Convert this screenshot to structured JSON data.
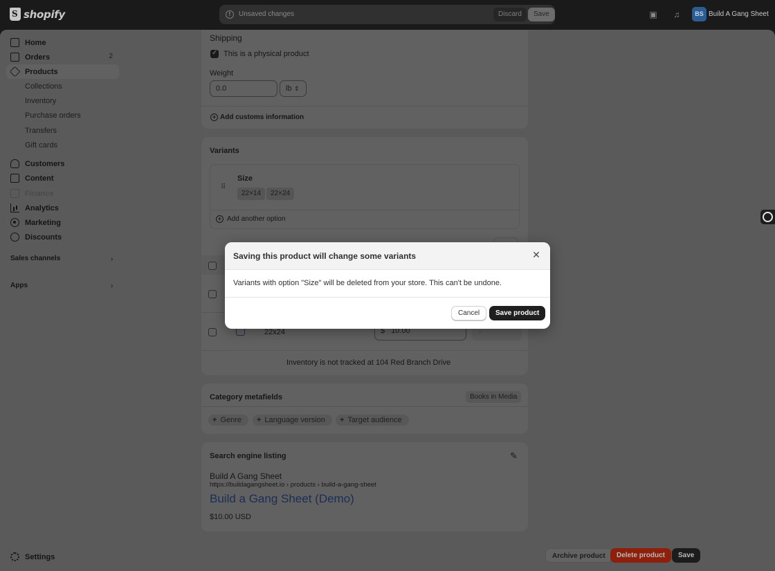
{
  "topbar": {
    "logo_text": "shopify",
    "unsaved_text": "Unsaved changes",
    "discard_label": "Discard",
    "save_label": "Save",
    "store_initials": "BS",
    "store_name": "Build A Gang Sheet"
  },
  "sidebar": {
    "items": [
      {
        "label": "Home",
        "icon": "home-icon"
      },
      {
        "label": "Orders",
        "icon": "orders-icon",
        "count": "2"
      },
      {
        "label": "Products",
        "icon": "tag-icon"
      },
      {
        "label": "Collections"
      },
      {
        "label": "Inventory"
      },
      {
        "label": "Purchase orders"
      },
      {
        "label": "Transfers"
      },
      {
        "label": "Gift cards"
      },
      {
        "label": "Customers",
        "icon": "person-icon"
      },
      {
        "label": "Content",
        "icon": "content-icon"
      },
      {
        "label": "Finance",
        "icon": "finance-icon"
      },
      {
        "label": "Analytics",
        "icon": "analytics-icon"
      },
      {
        "label": "Marketing",
        "icon": "target-icon"
      },
      {
        "label": "Discounts",
        "icon": "discount-icon"
      }
    ],
    "sales_channels_label": "Sales channels",
    "apps_label": "Apps",
    "settings_label": "Settings"
  },
  "shipping": {
    "title": "Shipping",
    "physical_label": "This is a physical product",
    "weight_label": "Weight",
    "weight_value": "0.0",
    "weight_unit": "lb",
    "customs_label": "Add customs information"
  },
  "variants": {
    "title": "Variants",
    "option_name": "Size",
    "option_values": [
      "22×14",
      "22×24"
    ],
    "add_option_label": "Add another option",
    "row_name": "22x24",
    "row_price_prefix": "$",
    "row_price": "10.00",
    "row_qty": "-",
    "inventory_note": "Inventory is not tracked at 104 Red Branch Drive"
  },
  "category_metafields": {
    "title": "Category metafields",
    "badge": "Books in Media",
    "pills": [
      "Genre",
      "Language version",
      "Target audience"
    ]
  },
  "seo": {
    "title": "Search engine listing",
    "store_name": "Build A Gang Sheet",
    "url": "https://buildagangsheet.io › products › build-a-gang-sheet",
    "page_title": "Build a Gang Sheet (Demo)",
    "price": "$10.00 USD"
  },
  "modal": {
    "title": "Saving this product will change some variants",
    "body": "Variants with option \"Size\" will be deleted from your store. This can't be undone.",
    "cancel_label": "Cancel",
    "save_label": "Save product"
  },
  "footer": {
    "archive_label": "Archive product",
    "delete_label": "Delete product",
    "save_label": "Save"
  },
  "colors": {
    "modal_primary": "#1f1f1f",
    "delete_red": "#8e1f0b",
    "seo_blue": "#1b2e55"
  }
}
